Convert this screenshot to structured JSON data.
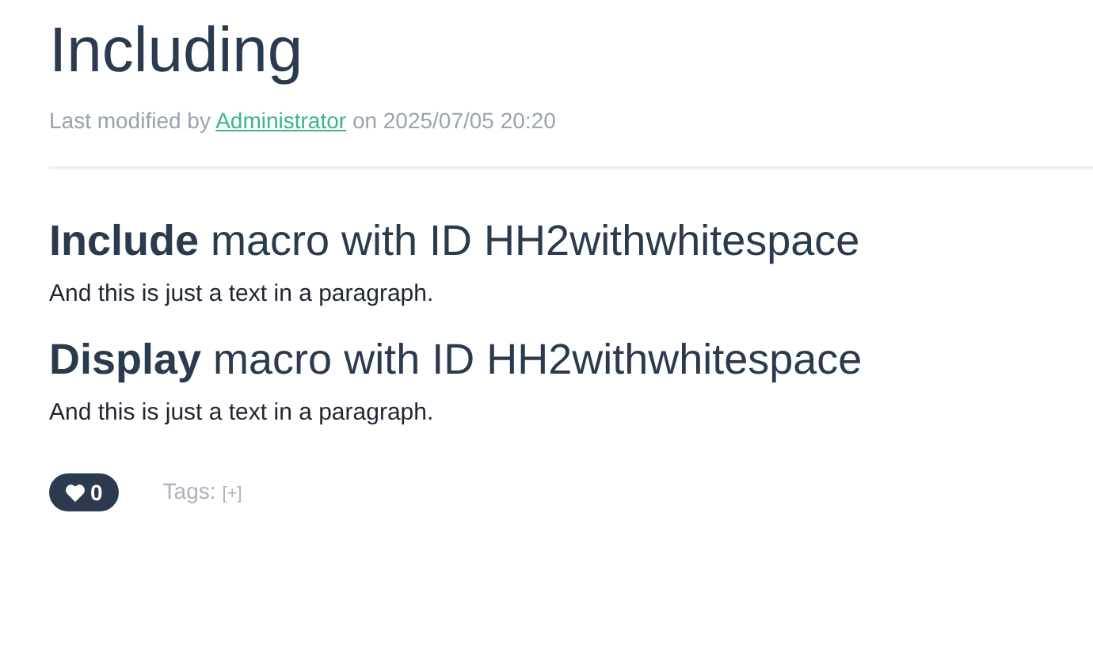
{
  "page": {
    "title": "Including",
    "meta": {
      "prefix": "Last modified by",
      "author": "Administrator",
      "suffix": "on 2025/07/05 20:20"
    }
  },
  "sections": [
    {
      "heading": "**Include** macro with ID HH2withwhitespace",
      "text": "And this is just a text in a paragraph."
    },
    {
      "heading": "**Display** macro with ID HH2withwhitespace",
      "text": "And this is just a text in a paragraph."
    }
  ],
  "footer": {
    "likes": "0",
    "tags_label": "Tags:",
    "add_tag": "[+]"
  }
}
